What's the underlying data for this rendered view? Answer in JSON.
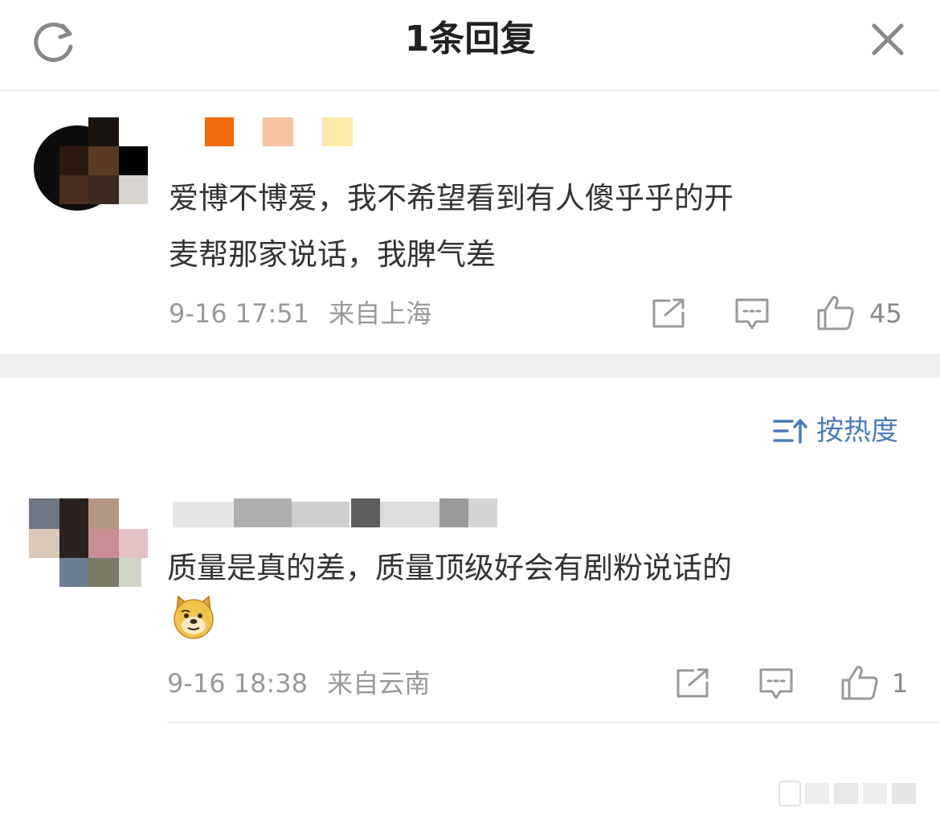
{
  "header": {
    "title": "1条回复",
    "refresh_icon": "refresh-icon",
    "close_icon": "close-icon"
  },
  "main_comment": {
    "text_line1": "爱博不博爱，我不希望看到有人傻乎乎的开",
    "text_line2": "麦帮那家说话，我脾气差",
    "time": "9-16 17:51",
    "location": "来自上海",
    "like_count": "45",
    "colors": {
      "badge1": "#f26a0c",
      "badge2": "#f6c4a3",
      "badge3": "#fbeaa8"
    }
  },
  "sort": {
    "label": "按热度",
    "icon": "sort-icon",
    "color": "#4a7bb7"
  },
  "reply": {
    "text_line1": "质量是真的差，质量顶级好会有剧粉说话的",
    "emoji": "doge-emoji",
    "time": "9-16 18:38",
    "location": "来自云南",
    "like_count": "1"
  }
}
